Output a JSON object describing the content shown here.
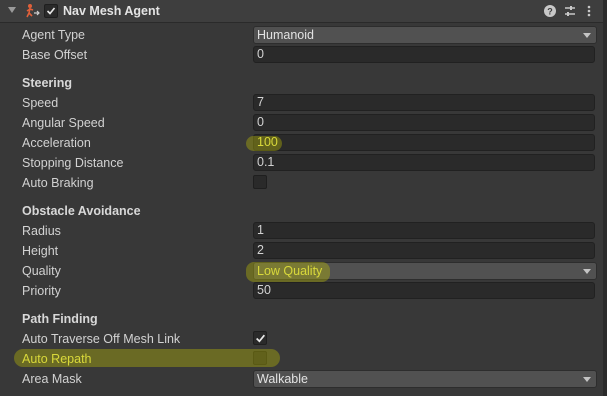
{
  "header": {
    "title": "Nav Mesh Agent",
    "enabled": true
  },
  "fields": {
    "agent_type": {
      "label": "Agent Type",
      "value": "Humanoid"
    },
    "base_offset": {
      "label": "Base Offset",
      "value": "0"
    }
  },
  "steering": {
    "title": "Steering",
    "speed": {
      "label": "Speed",
      "value": "7"
    },
    "angular_speed": {
      "label": "Angular Speed",
      "value": "0"
    },
    "acceleration": {
      "label": "Acceleration",
      "value": "100"
    },
    "stopping_distance": {
      "label": "Stopping Distance",
      "value": "0.1"
    },
    "auto_braking": {
      "label": "Auto Braking",
      "checked": false
    }
  },
  "obstacle": {
    "title": "Obstacle Avoidance",
    "radius": {
      "label": "Radius",
      "value": "1"
    },
    "height": {
      "label": "Height",
      "value": "2"
    },
    "quality": {
      "label": "Quality",
      "value": "Low Quality"
    },
    "priority": {
      "label": "Priority",
      "value": "50"
    }
  },
  "path": {
    "title": "Path Finding",
    "auto_traverse": {
      "label": "Auto Traverse Off Mesh Link",
      "checked": true
    },
    "auto_repath": {
      "label": "Auto Repath",
      "checked": false
    },
    "area_mask": {
      "label": "Area Mask",
      "value": "Walkable"
    }
  },
  "colors": {
    "background": "#383838",
    "highlight": "#c8c800",
    "field": "#2a2a2a"
  }
}
